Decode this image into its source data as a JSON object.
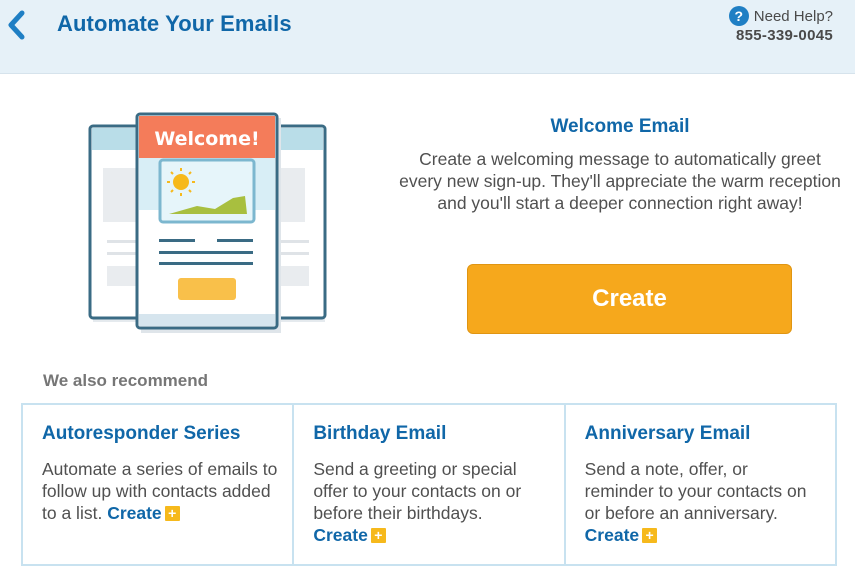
{
  "header": {
    "title": "Automate Your Emails",
    "help_label": "Need Help?",
    "help_icon": "question-icon",
    "phone": "855-339-0045"
  },
  "illustration": {
    "banner_text": "Welcome!",
    "colors": {
      "banner": "#f47c5a",
      "frame": "#3a6b84",
      "pale_blue": "#b9dde8",
      "landscape": "#a8bf3f",
      "sun": "#f6b91c",
      "button": "#f9c04a"
    }
  },
  "feature": {
    "title": "Welcome Email",
    "description": "Create a welcoming message to automatically greet every new sign-up. They'll appreciate the warm reception and you'll start a deeper connection right away!",
    "button_label": "Create"
  },
  "recommend": {
    "heading": "We also recommend",
    "cards": [
      {
        "title": "Autoresponder Series",
        "description": "Automate a series of emails to follow up with contacts added to a list.",
        "link": "Create"
      },
      {
        "title": "Birthday Email",
        "description": "Send a greeting or special offer to your contacts on or before their birthdays.",
        "link": "Create"
      },
      {
        "title": "Anniversary Email",
        "description": "Send a note, offer, or reminder to your contacts on or before an anniversary.",
        "link": "Create"
      }
    ]
  },
  "colors": {
    "brand_blue": "#1067a8",
    "accent_orange": "#f6a81c",
    "header_bg": "#e6f1f8"
  }
}
